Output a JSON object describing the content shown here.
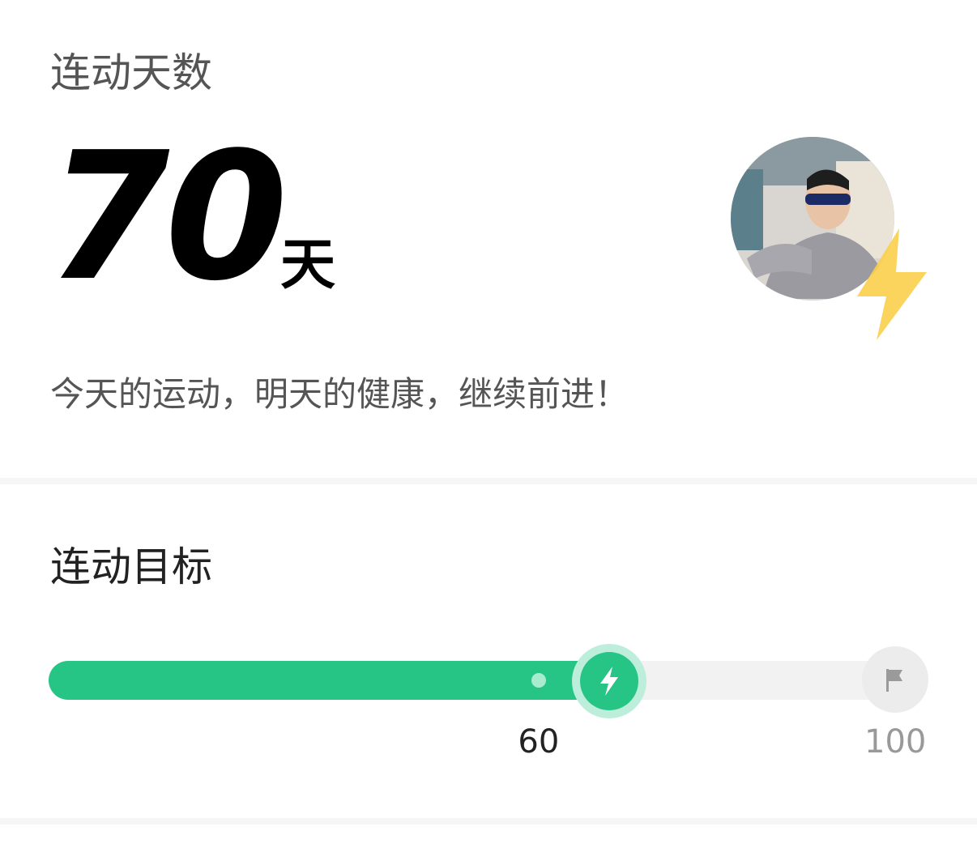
{
  "streak": {
    "title": "连动天数",
    "days": "70",
    "unit": "天",
    "motto": "今天的运动，明天的健康，继续前进！",
    "avatar_icon": "user-avatar-photo",
    "badge_icon": "lightning-bolt-icon"
  },
  "goal": {
    "title": "连动目标",
    "milestone_label": "60",
    "goal_label": "100",
    "current_value": 70,
    "milestone_value": 60,
    "max_value": 100,
    "current_icon": "lightning-bolt-icon",
    "goal_icon": "flag-icon"
  },
  "colors": {
    "accent": "#26c585",
    "accent_light": "#bdeedb",
    "badge": "#f9cf4a",
    "track": "#f2f2f2"
  }
}
